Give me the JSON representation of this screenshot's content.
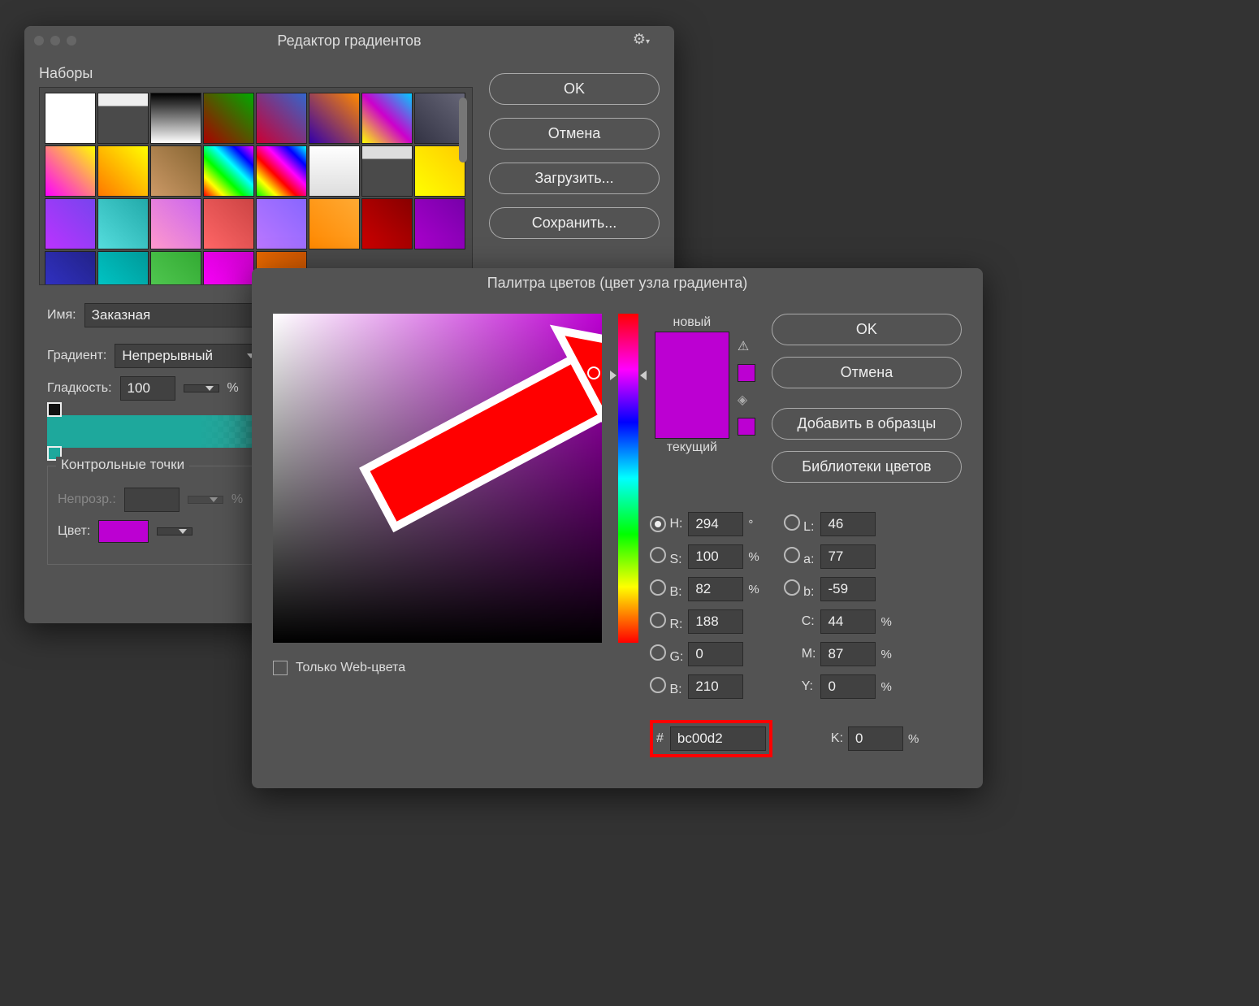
{
  "gradient_editor": {
    "title": "Редактор градиентов",
    "presets_label": "Наборы",
    "buttons": {
      "ok": "OK",
      "cancel": "Отмена",
      "load": "Загрузить...",
      "save": "Сохранить..."
    },
    "name_label": "Имя:",
    "name_value": "Заказная",
    "gradient_label": "Градиент:",
    "gradient_type": "Непрерывный",
    "smoothness_label": "Гладкость:",
    "smoothness_value": "100",
    "smoothness_unit": "%",
    "stops_legend": "Контрольные точки",
    "opacity_label": "Непрозр.:",
    "opacity_unit": "%",
    "color_label": "Цвет:",
    "stop_color": "#bc00d2",
    "swatches": [
      "linear-gradient(#fff,#fff)",
      "linear-gradient(#eee 25%, transparent 25%)",
      "linear-gradient(#000,#fff)",
      "linear-gradient(45deg,#a00,#0a0)",
      "linear-gradient(45deg,#c03,#36c)",
      "linear-gradient(45deg,#30a,#f80)",
      "linear-gradient(45deg,#ff0,#c0c,#0cf)",
      "linear-gradient(45deg,#334,#667)",
      "linear-gradient(45deg,#f0f,#ff0)",
      "linear-gradient(45deg,#f70,#ff0)",
      "linear-gradient(45deg,#c96,#863)",
      "linear-gradient(45deg,#f00,#ff0,#0f0,#0ff,#00f,#f0f)",
      "linear-gradient(45deg,#0f0,#ff0,#f00,#f0f,#00f,#0ff)",
      "linear-gradient(#fff,#ddd)",
      "linear-gradient(#ddd 25%, transparent 25%)",
      "linear-gradient(45deg,#ff0,#fc0)",
      "linear-gradient(45deg,#b3f,#74e)",
      "linear-gradient(45deg,#5dd,#2aa)",
      "linear-gradient(45deg,#f9c,#c6e)",
      "linear-gradient(45deg,#f66,#c44)",
      "linear-gradient(45deg,#b7f,#86f)",
      "linear-gradient(45deg,#f80,#fa3)",
      "linear-gradient(45deg,#c00,#800)",
      "linear-gradient(45deg,#a0c,#70a)",
      "linear-gradient(45deg,#33c,#228)",
      "linear-gradient(45deg,#0cc,#099)",
      "linear-gradient(45deg,#5c5,#3a3)",
      "linear-gradient(45deg,#f0f,#c0c)",
      "linear-gradient(45deg,#f70,#c50)"
    ]
  },
  "color_picker": {
    "title": "Палитра цветов (цвет узла градиента)",
    "buttons": {
      "ok": "OK",
      "cancel": "Отмена",
      "add": "Добавить в образцы",
      "lib": "Библиотеки цветов"
    },
    "new_label": "новый",
    "current_label": "текущий",
    "web_only": "Только Web-цвета",
    "h_label": "H:",
    "h": "294",
    "s_label": "S:",
    "s": "100",
    "b_label": "B:",
    "b": "82",
    "r_label": "R:",
    "r": "188",
    "g_label": "G:",
    "g": "0",
    "bl_label": "B:",
    "bl": "210",
    "l_label": "L:",
    "l": "46",
    "a_label": "a:",
    "a": "77",
    "lb_label": "b:",
    "lb": "-59",
    "c_label": "C:",
    "c": "44",
    "m_label": "M:",
    "m": "87",
    "y_label": "Y:",
    "y": "0",
    "k_label": "K:",
    "k": "0",
    "deg": "°",
    "pct": "%",
    "hex_prefix": "#",
    "hex": "bc00d2"
  }
}
